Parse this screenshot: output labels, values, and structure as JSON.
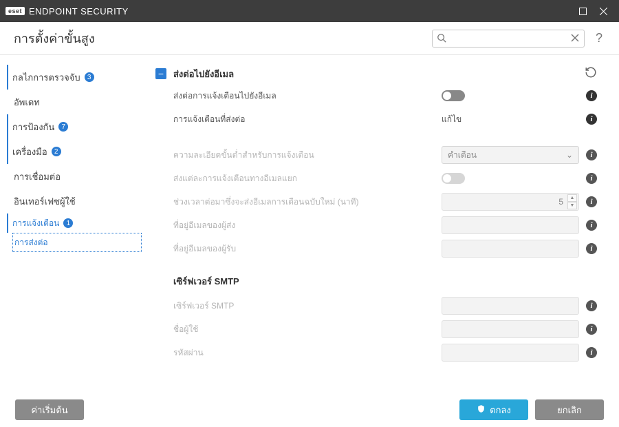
{
  "titlebar": {
    "brand_badge": "eset",
    "brand_text": "ENDPOINT SECURITY"
  },
  "header": {
    "title": "การตั้งค่าขั้นสูง",
    "search_placeholder": ""
  },
  "sidebar": {
    "items": [
      {
        "label": "กลไกการตรวจจับ",
        "badge": "3"
      },
      {
        "label": "อัพเดท",
        "badge": ""
      },
      {
        "label": "การป้องกัน",
        "badge": "7"
      },
      {
        "label": "เครื่องมือ",
        "badge": "2"
      },
      {
        "label": "การเชื่อมต่อ",
        "badge": ""
      },
      {
        "label": "อินเทอร์เฟซผู้ใช้",
        "badge": ""
      }
    ],
    "sub": [
      {
        "label": "การแจ้งเตือน",
        "badge": "1"
      },
      {
        "label": "การส่งต่อ",
        "badge": ""
      }
    ]
  },
  "section": {
    "title": "ส่งต่อไปยังอีเมล",
    "rows": {
      "forward_enable": "ส่งต่อการแจ้งเตือนไปยังอีเมล",
      "forward_notify": "การแจ้งเตือนที่ส่งต่อ",
      "forward_notify_value": "แก้ไข",
      "min_level": "ความละเอียดขั้นต่ำสำหรับการแจ้งเตือน",
      "min_level_value": "คำเตือน",
      "separate_email": "ส่งแต่ละการแจ้งเตือนทางอีเมลแยก",
      "interval": "ช่วงเวลาต่อมาซึ่งจะส่งอีเมลการเตือนฉบับใหม่ (นาที)",
      "interval_value": "5",
      "sender_addr": "ที่อยู่อีเมลของผู้ส่ง",
      "recipient_addr": "ที่อยู่อีเมลของผู้รับ"
    },
    "smtp": {
      "title": "เซิร์ฟเวอร์ SMTP",
      "server": "เซิร์ฟเวอร์ SMTP",
      "username": "ชื่อผู้ใช้",
      "password": "รหัสผ่าน"
    }
  },
  "footer": {
    "defaults": "ค่าเริ่มต้น",
    "ok": "ตกลง",
    "cancel": "ยกเลิก"
  }
}
